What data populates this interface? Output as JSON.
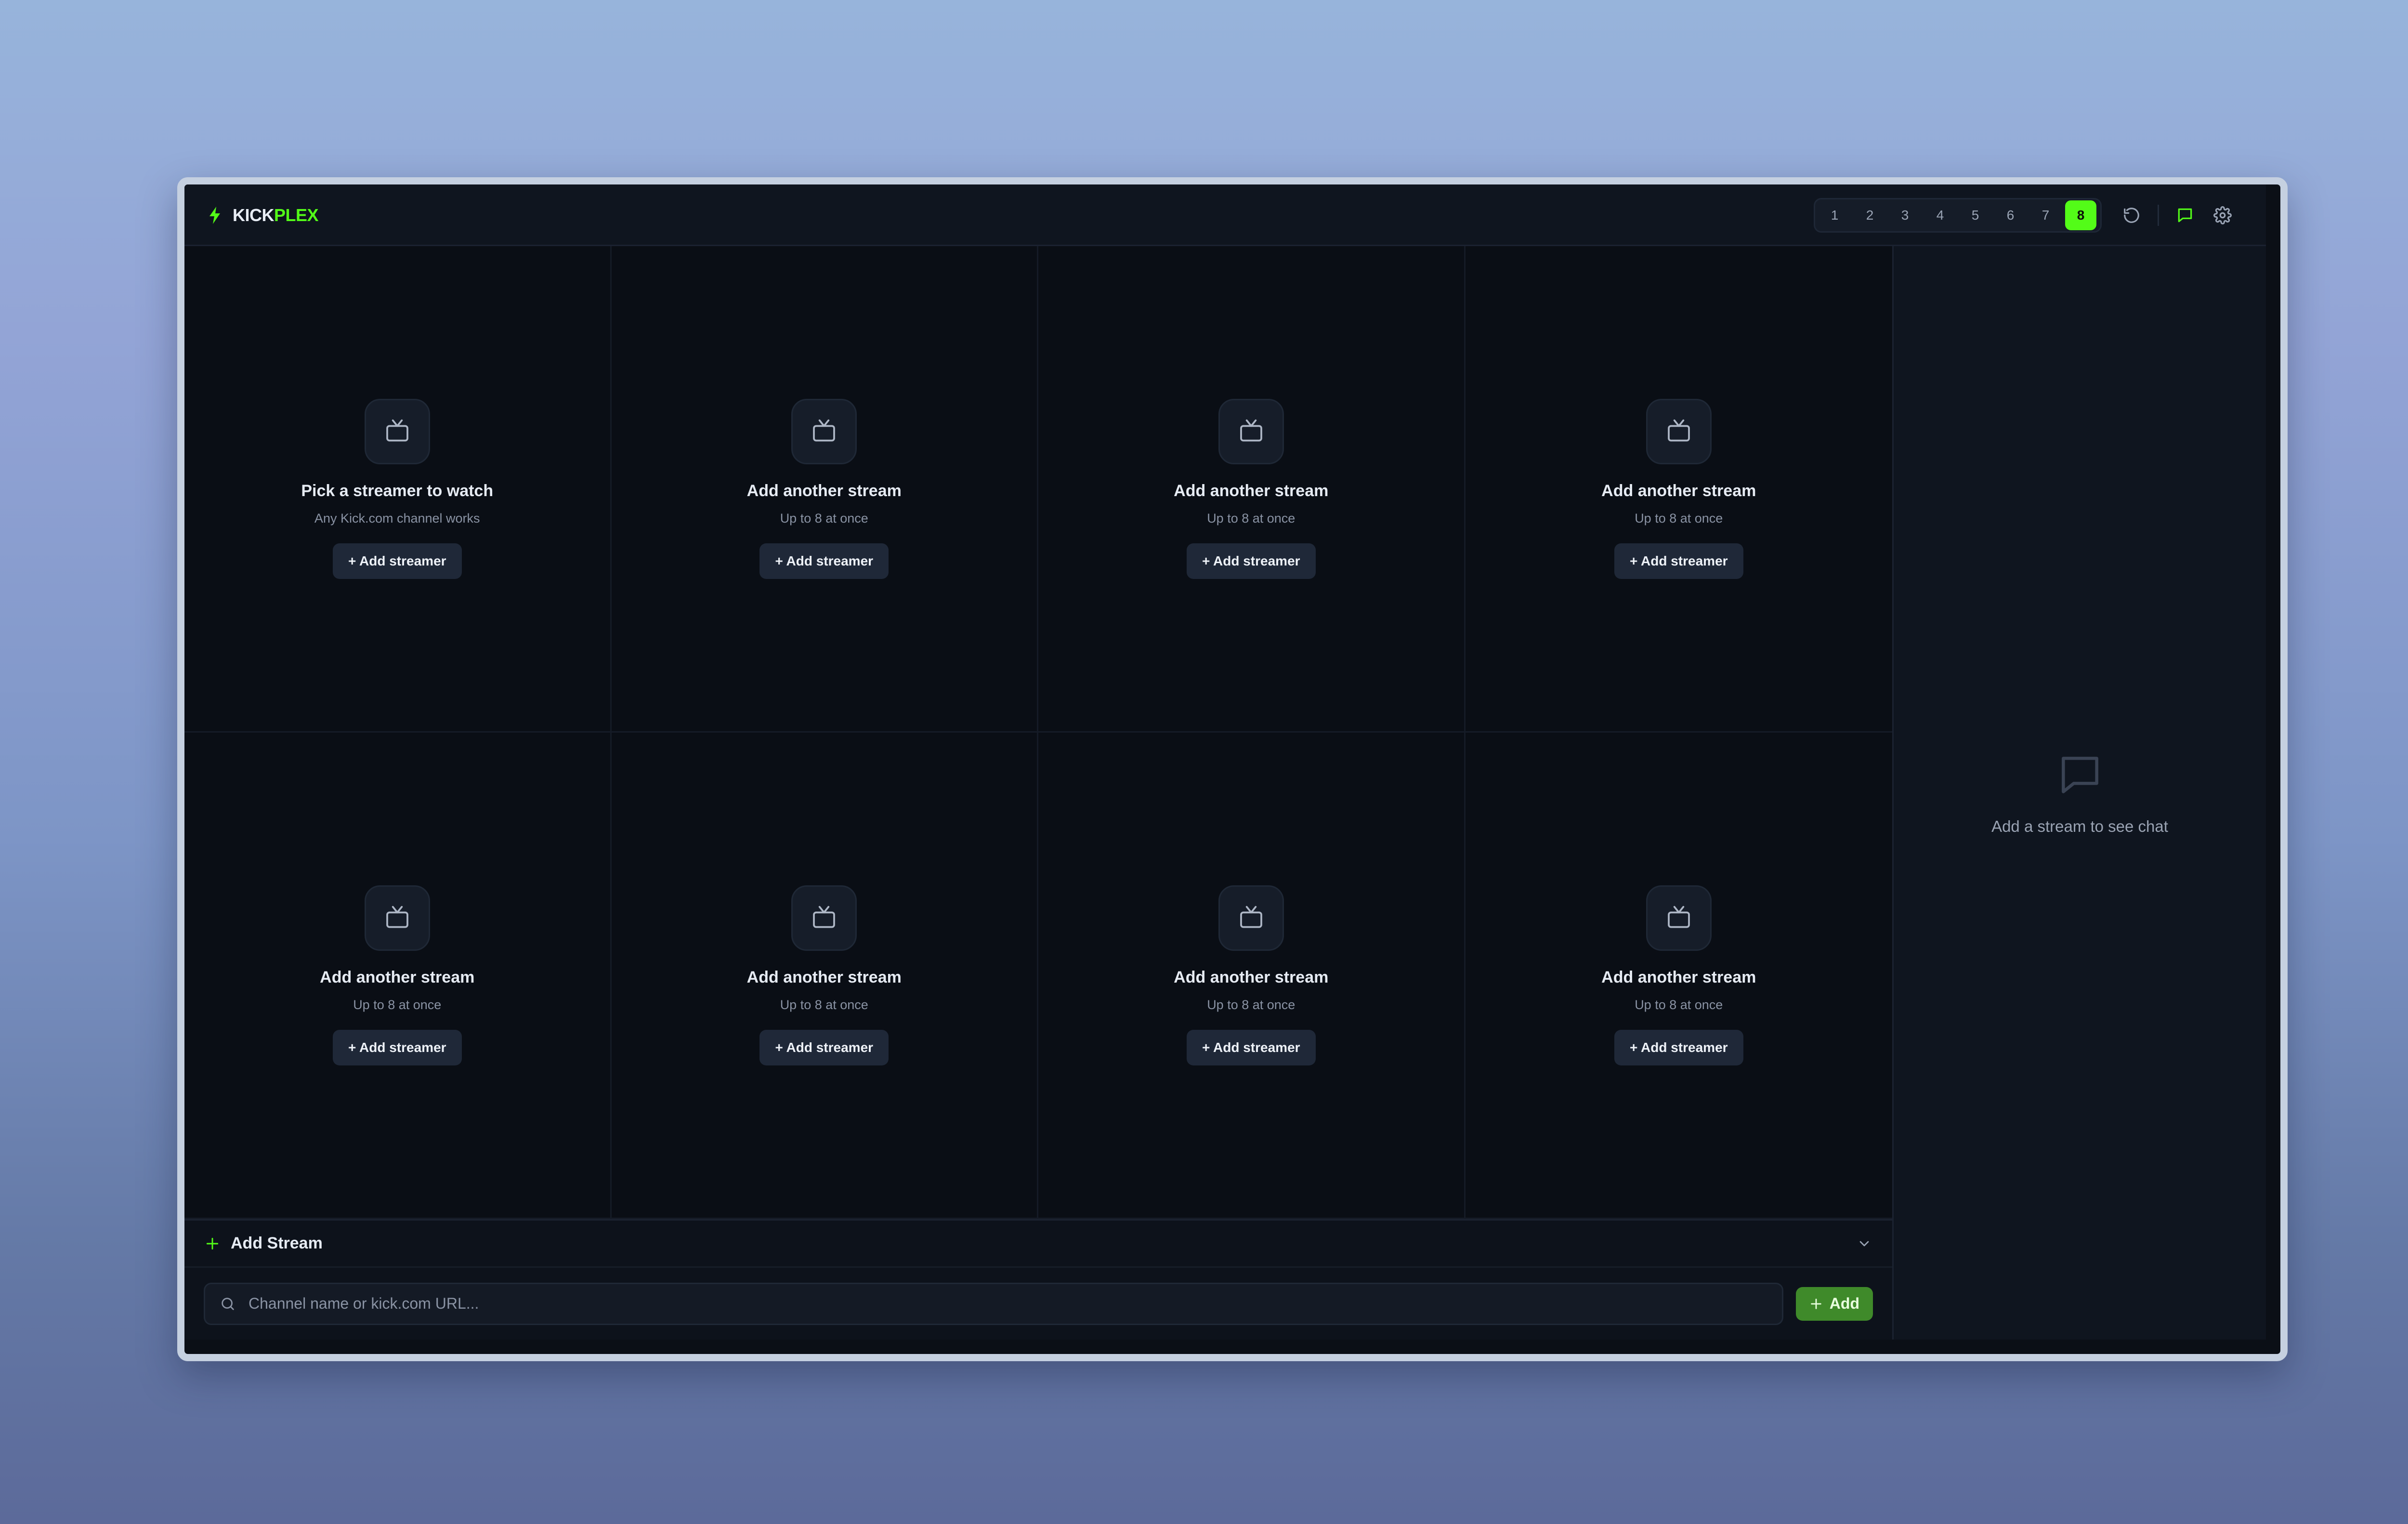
{
  "app": {
    "logo_primary": "KICK",
    "logo_accent": "PLEX",
    "accent_color": "#53fc18"
  },
  "header": {
    "layout_options": [
      "1",
      "2",
      "3",
      "4",
      "5",
      "6",
      "7",
      "8"
    ],
    "selected_layout": "8",
    "icons": [
      "refresh-icon",
      "chat-toggle-icon",
      "settings-icon"
    ]
  },
  "tiles": [
    {
      "title": "Pick a streamer to watch",
      "subtitle": "Any Kick.com channel works",
      "button": "+ Add streamer"
    },
    {
      "title": "Add another stream",
      "subtitle": "Up to 8 at once",
      "button": "+ Add streamer"
    },
    {
      "title": "Add another stream",
      "subtitle": "Up to 8 at once",
      "button": "+ Add streamer"
    },
    {
      "title": "Add another stream",
      "subtitle": "Up to 8 at once",
      "button": "+ Add streamer"
    },
    {
      "title": "Add another stream",
      "subtitle": "Up to 8 at once",
      "button": "+ Add streamer"
    },
    {
      "title": "Add another stream",
      "subtitle": "Up to 8 at once",
      "button": "+ Add streamer"
    },
    {
      "title": "Add another stream",
      "subtitle": "Up to 8 at once",
      "button": "+ Add streamer"
    },
    {
      "title": "Add another stream",
      "subtitle": "Up to 8 at once",
      "button": "+ Add streamer"
    }
  ],
  "add_stream": {
    "title": "Add Stream",
    "input_value": "",
    "placeholder": "Channel name or kick.com URL...",
    "button_label": "Add"
  },
  "chat": {
    "empty_text": "Add a stream to see chat"
  }
}
